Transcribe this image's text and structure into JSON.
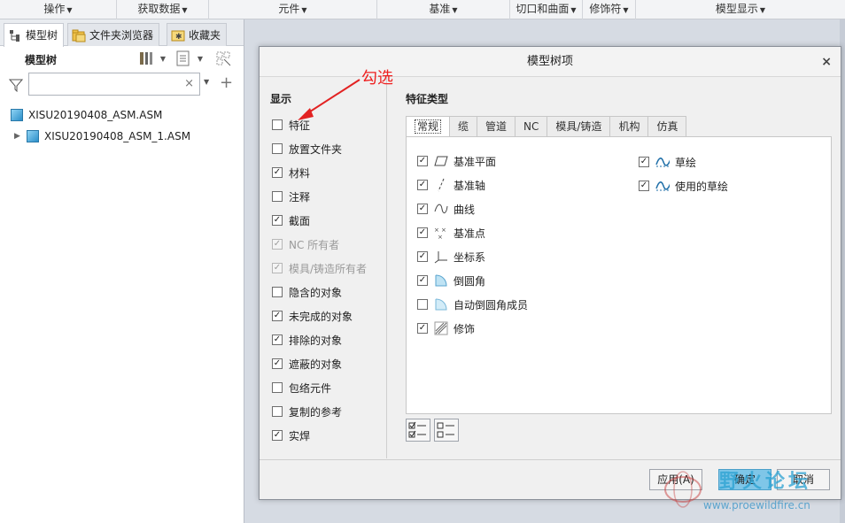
{
  "ribbon": {
    "groups": [
      {
        "label": "操作"
      },
      {
        "label": "获取数据"
      },
      {
        "label": "元件"
      },
      {
        "label": "基准"
      },
      {
        "label": "切口和曲面"
      },
      {
        "label": "修饰符"
      },
      {
        "label": "模型显示"
      }
    ]
  },
  "left_pane": {
    "tabs": [
      {
        "label": "模型树",
        "icon": "model-tree-icon",
        "active": true
      },
      {
        "label": "文件夹浏览器",
        "icon": "folder-browser-icon",
        "active": false
      },
      {
        "label": "收藏夹",
        "icon": "favorites-icon",
        "active": false
      }
    ],
    "toolbar_title": "模型树",
    "search": {
      "value": "",
      "placeholder": ""
    },
    "tree": [
      {
        "label": "XISU20190408_ASM.ASM",
        "expandable": false
      },
      {
        "label": "XISU20190408_ASM_1.ASM",
        "expandable": true
      }
    ]
  },
  "dialog": {
    "title": "模型树项",
    "close": "×",
    "display": {
      "title": "显示",
      "items": [
        {
          "label": "特征",
          "checked": false,
          "disabled": false
        },
        {
          "label": "放置文件夹",
          "checked": false,
          "disabled": false
        },
        {
          "label": "材料",
          "checked": true,
          "disabled": false
        },
        {
          "label": "注释",
          "checked": false,
          "disabled": false
        },
        {
          "label": "截面",
          "checked": true,
          "disabled": false
        },
        {
          "label": "NC 所有者",
          "checked": true,
          "disabled": true
        },
        {
          "label": "模具/铸造所有者",
          "checked": true,
          "disabled": true
        },
        {
          "label": "隐含的对象",
          "checked": false,
          "disabled": false
        },
        {
          "label": "未完成的对象",
          "checked": true,
          "disabled": false
        },
        {
          "label": "排除的对象",
          "checked": true,
          "disabled": false
        },
        {
          "label": "遮蔽的对象",
          "checked": true,
          "disabled": false
        },
        {
          "label": "包络元件",
          "checked": false,
          "disabled": false
        },
        {
          "label": "复制的参考",
          "checked": false,
          "disabled": false
        },
        {
          "label": "实焊",
          "checked": true,
          "disabled": false
        }
      ]
    },
    "feature_types": {
      "title": "特征类型",
      "tabs": [
        "常规",
        "缆",
        "管道",
        "NC",
        "模具/铸造",
        "机构",
        "仿真"
      ],
      "active_tab": "常规",
      "left_items": [
        {
          "label": "基准平面",
          "checked": true,
          "icon": "datum-plane-icon"
        },
        {
          "label": "基准轴",
          "checked": true,
          "icon": "datum-axis-icon"
        },
        {
          "label": "曲线",
          "checked": true,
          "icon": "curve-icon"
        },
        {
          "label": "基准点",
          "checked": true,
          "icon": "datum-point-icon"
        },
        {
          "label": "坐标系",
          "checked": true,
          "icon": "coordinate-system-icon"
        },
        {
          "label": "倒圆角",
          "checked": true,
          "icon": "round-icon"
        },
        {
          "label": "自动倒圆角成员",
          "checked": false,
          "icon": "auto-round-member-icon"
        },
        {
          "label": "修饰",
          "checked": true,
          "icon": "cosmetic-icon"
        }
      ],
      "right_items": [
        {
          "label": "草绘",
          "checked": true,
          "icon": "sketch-icon"
        },
        {
          "label": "使用的草绘",
          "checked": true,
          "icon": "used-sketch-icon"
        }
      ]
    },
    "buttons": {
      "apply": "应用(A)",
      "ok": "确定",
      "cancel": "取消"
    }
  },
  "annotation": {
    "text": "勾选",
    "color": "#e22222"
  },
  "watermark": {
    "title": "野火论坛",
    "url": "www.proewildfire.cn"
  }
}
